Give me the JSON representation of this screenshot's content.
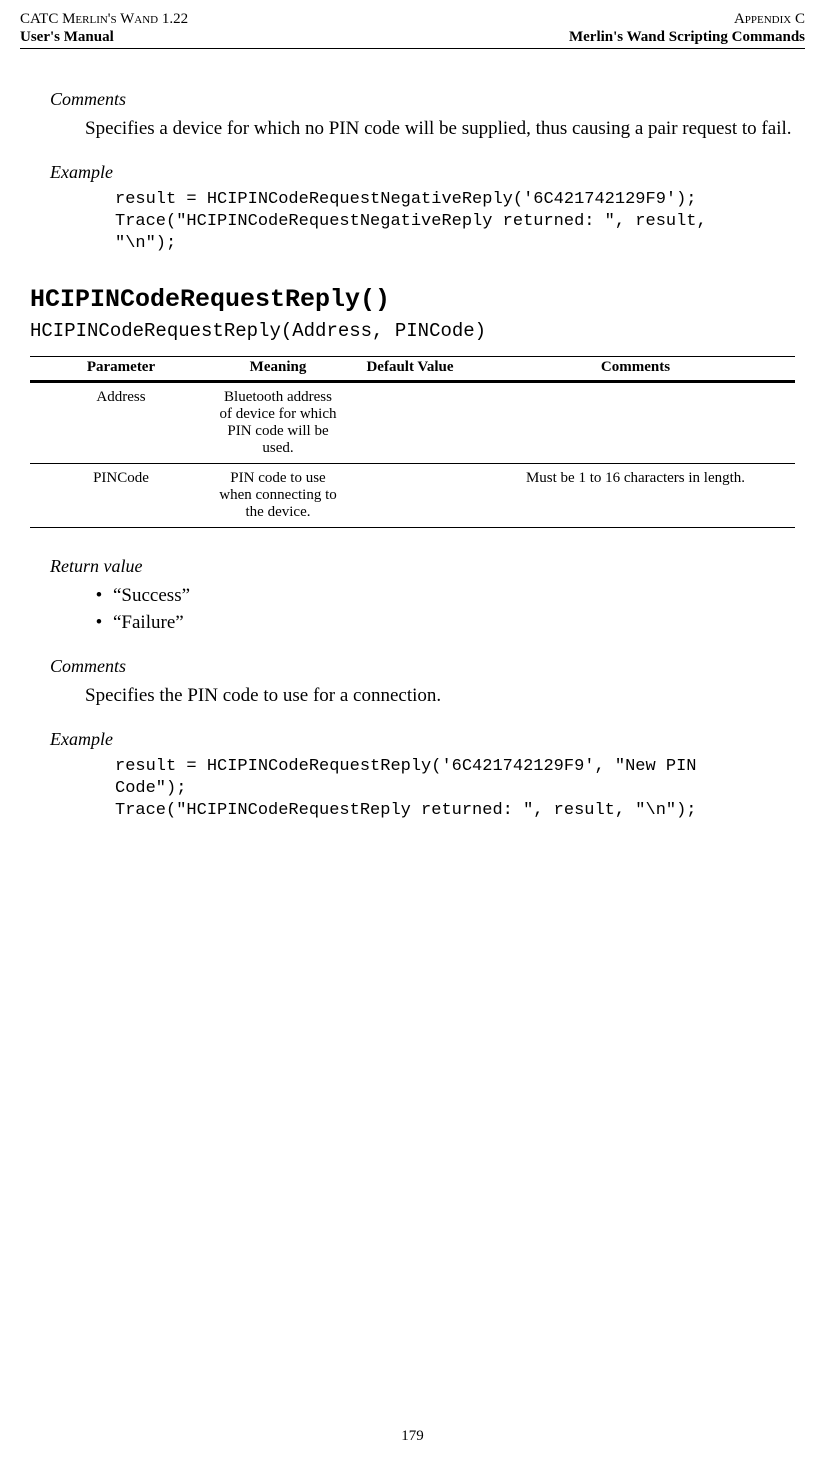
{
  "header": {
    "top_left": "CATC Merlin's Wand 1.22",
    "top_right": "Appendix C",
    "sub_left": "User's Manual",
    "sub_right": "Merlin's Wand Scripting Commands"
  },
  "section1": {
    "comments_label": "Comments",
    "comments_text": "Specifies a device for which no PIN code will be supplied, thus causing a pair request to fail.",
    "example_label": "Example",
    "example_code": "result = HCIPINCodeRequestNegativeReply('6C421742129F9');\nTrace(\"HCIPINCodeRequestNegativeReply returned: \", result,\n\"\\n\");"
  },
  "func": {
    "heading": "HCIPINCodeRequestReply()",
    "signature": "HCIPINCodeRequestReply(Address, PINCode)"
  },
  "table": {
    "headers": {
      "parameter": "Parameter",
      "meaning": "Meaning",
      "default": "Default Value",
      "comments": "Comments"
    },
    "rows": [
      {
        "parameter": "Address",
        "meaning": "Bluetooth address of device for which PIN code will be used.",
        "default": "",
        "comments": ""
      },
      {
        "parameter": "PINCode",
        "meaning": "PIN code to use when connecting to the device.",
        "default": "",
        "comments": "Must be 1 to 16 characters in length."
      }
    ]
  },
  "section2": {
    "return_label": "Return value",
    "return_values": [
      "“Success”",
      "“Failure”"
    ],
    "comments_label": "Comments",
    "comments_text": "Specifies the PIN code to use for a connection.",
    "example_label": "Example",
    "example_code": "result = HCIPINCodeRequestReply('6C421742129F9', \"New PIN\nCode\");\nTrace(\"HCIPINCodeRequestReply returned: \", result, \"\\n\");"
  },
  "page_number": "179"
}
